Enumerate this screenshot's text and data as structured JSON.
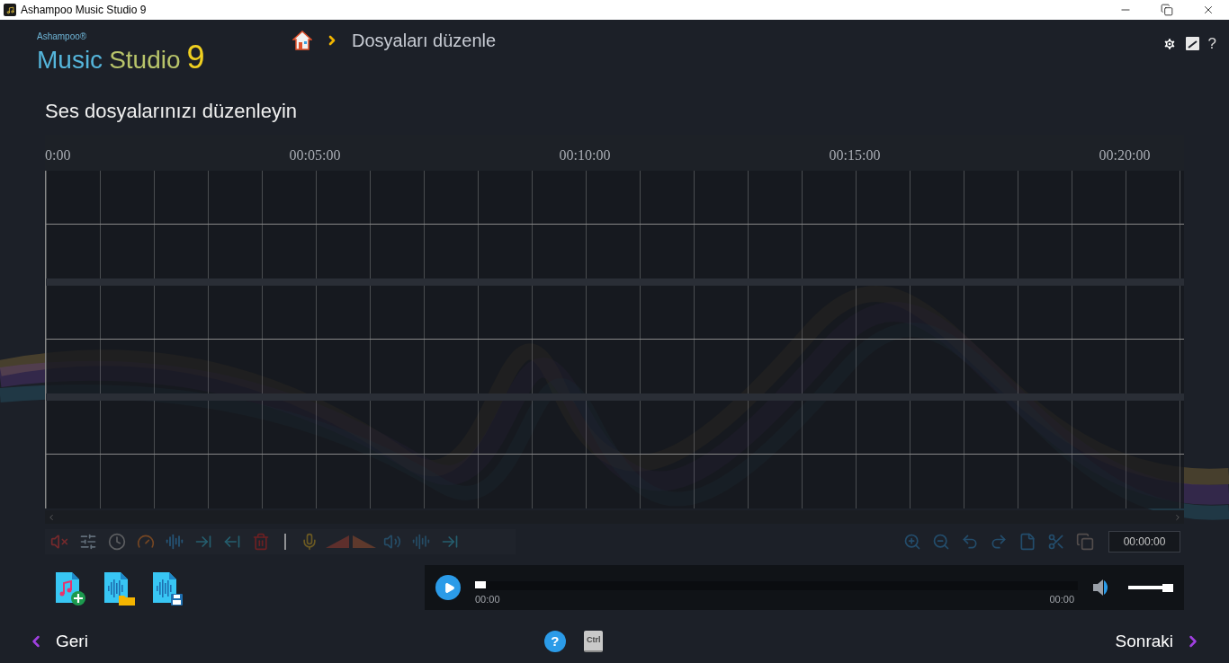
{
  "window": {
    "title": "Ashampoo Music Studio 9"
  },
  "logo": {
    "brand": "Ashampoo®",
    "word1": "Music",
    "word2": "Studio",
    "version": "9"
  },
  "breadcrumb": {
    "page": "Dosyaları düzenle"
  },
  "header_help": "?",
  "heading": "Ses dosyalarınızı düzenleyin",
  "ruler": [
    "0:00",
    "00:05:00",
    "00:10:00",
    "00:15:00",
    "00:20:00"
  ],
  "time_field": {
    "value": "00:00:00"
  },
  "player": {
    "position": {
      "level": 0
    },
    "start_time": "00:00",
    "end_time": "00:00",
    "volume": {
      "level": 1
    }
  },
  "footer": {
    "back": "Geri",
    "help": "?",
    "key": "Ctrl",
    "next": "Sonraki"
  }
}
